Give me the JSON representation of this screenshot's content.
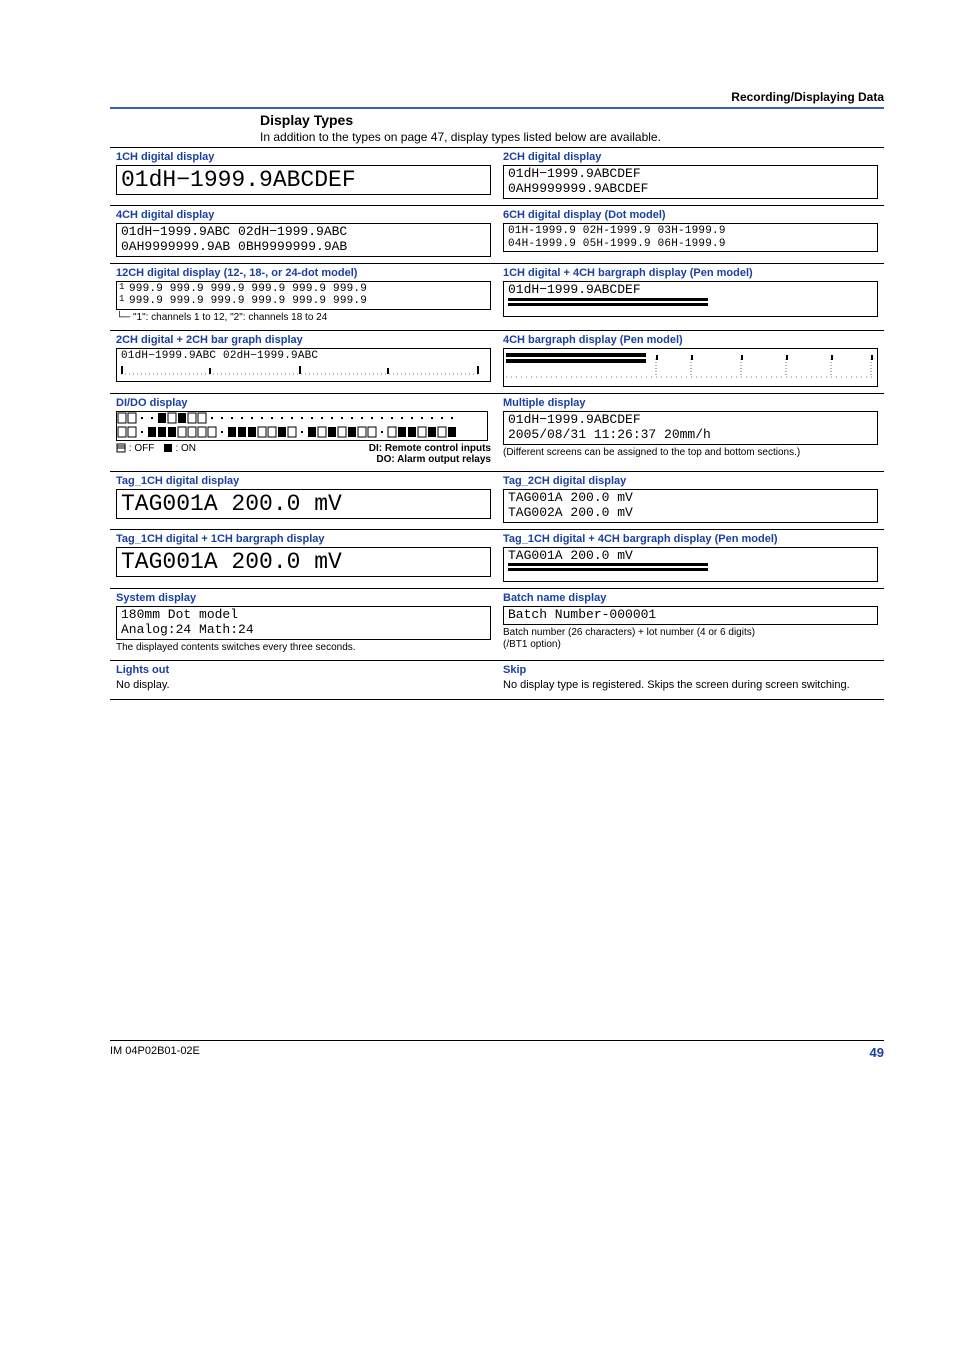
{
  "header": {
    "right": "Recording/Displaying Data"
  },
  "section": {
    "title": "Display Types",
    "intro": "In addition to the types on page 47, display types listed below are available."
  },
  "rows": [
    {
      "left": {
        "title": "1CH digital display",
        "type": "box",
        "size": "lg",
        "lines": [
          "01dH−1999.9ABCDEF"
        ]
      },
      "right": {
        "title": "2CH digital display",
        "type": "box",
        "size": "md",
        "lines": [
          "01dH−1999.9ABCDEF",
          "0AH9999999.9ABCDEF"
        ]
      }
    },
    {
      "left": {
        "title": "4CH digital display",
        "type": "box",
        "size": "md",
        "lines": [
          "01dH−1999.9ABC 02dH−1999.9ABC",
          "0AH9999999.9AB 0BH9999999.9AB"
        ]
      },
      "right": {
        "title": "6CH digital display (Dot model)",
        "type": "box",
        "size": "sm",
        "lines": [
          "01H-1999.9 02H-1999.9 03H-1999.9",
          "04H-1999.9 05H-1999.9 06H-1999.9"
        ]
      }
    },
    {
      "left": {
        "title": "12CH digital display (12-, 18-, or 24-dot model)",
        "type": "box12",
        "size": "sm",
        "lines": [
          "999.9 999.9 999.9 999.9 999.9 999.9",
          "999.9 999.9 999.9 999.9 999.9 999.9"
        ],
        "note": "\"1\": channels 1 to 12, \"2\": channels 18 to 24"
      },
      "right": {
        "title": "1CH digital + 4CH bargraph display (Pen model)",
        "type": "box_bars1",
        "size": "md",
        "lines": [
          "01dH−1999.9ABCDEF"
        ]
      }
    },
    {
      "left": {
        "title": "2CH digital + 2CH bar graph display",
        "type": "box_bars2v",
        "size": "sm",
        "lines": [
          "01dH−1999.9ABC 02dH−1999.9ABC"
        ]
      },
      "right": {
        "title": "4CH bargraph display (Pen model)",
        "type": "bars4"
      }
    },
    {
      "left": {
        "title": "DI/DO display",
        "type": "dido",
        "legend_off": ": OFF",
        "legend_on": ": ON",
        "note1": "DI: Remote control inputs",
        "note2": "DO: Alarm output relays"
      },
      "right": {
        "title": "Multiple display",
        "type": "box",
        "size": "md",
        "lines": [
          "01dH−1999.9ABCDEF",
          "2005/08/31 11:26:37 20mm/h"
        ],
        "note": "(Different screens can be assigned to the top and bottom sections.)"
      }
    },
    {
      "left": {
        "title": "Tag_1CH digital display",
        "type": "box",
        "size": "lg",
        "lines": [
          "TAG001A 200.0 mV"
        ]
      },
      "right": {
        "title": "Tag_2CH digital display",
        "type": "box",
        "size": "md",
        "lines": [
          "TAG001A 200.0 mV",
          "TAG002A 200.0 mV"
        ]
      }
    },
    {
      "left": {
        "title": "Tag_1CH digital + 1CH bargraph display",
        "type": "box_bars_under",
        "size": "lg",
        "lines": [
          "TAG001A 200.0 mV"
        ]
      },
      "right": {
        "title": "Tag_1CH digital + 4CH bargraph display (Pen model)",
        "type": "box_bars1",
        "size": "md",
        "lines": [
          "TAG001A 200.0 mV"
        ]
      }
    },
    {
      "left": {
        "title": "System display",
        "type": "box",
        "size": "md",
        "lines": [
          "180mm Dot model",
          "Analog:24 Math:24"
        ],
        "note": "The displayed contents switches every three seconds."
      },
      "right": {
        "title": "Batch name display",
        "type": "box",
        "size": "md",
        "lines": [
          "Batch Number-000001"
        ],
        "note": "Batch number (26 characters) + lot number (4 or 6 digits)\n(/BT1 option)"
      }
    },
    {
      "left": {
        "title": "Lights out",
        "type": "plain",
        "text": "No display."
      },
      "right": {
        "title": "Skip",
        "type": "plain",
        "text": "No display type is registered. Skips the screen during screen switching."
      }
    }
  ],
  "footer": {
    "left": "IM 04P02B01-02E",
    "page": "49"
  }
}
